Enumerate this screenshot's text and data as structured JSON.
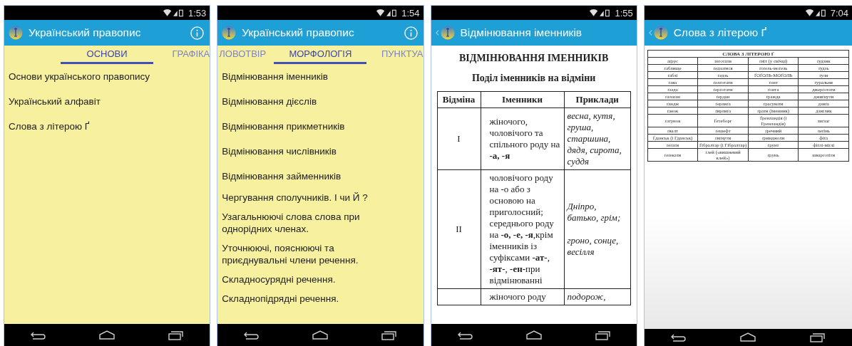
{
  "phones": [
    {
      "kind": "list",
      "status": {
        "time": "1:53"
      },
      "app_bar": {
        "title": "Український правопис",
        "back": false,
        "info": true
      },
      "tabs": [
        {
          "label": "ОСНОВИ",
          "selected": true
        },
        {
          "label": "ГРАФІКА",
          "selected": false
        }
      ],
      "items": [
        "Основи українського правопису",
        "Український алфавіт",
        "Слова з літерою Ґ"
      ]
    },
    {
      "kind": "list",
      "status": {
        "time": "1:54"
      },
      "app_bar": {
        "title": "Український правопис",
        "back": false,
        "info": true
      },
      "tabs": [
        {
          "label": "ЛОВОТВІР",
          "selected": false
        },
        {
          "label": "МОРФОЛОГІЯ",
          "selected": true
        },
        {
          "label": "ПУНКТУА",
          "selected": false
        }
      ],
      "items": [
        "Відмінювання іменників",
        "Відмінювання дієслів",
        "Відмінювання прикметників",
        "Відмінювання числівників",
        "Відмінювання займенників",
        "Чергування сполучників. І чи Й ?",
        "Узагальнюючі слова слова при однорідних членах.",
        "Уточнюючі, пояснюючі та приєднувальні члени речення.",
        "Складносурядні речення.",
        "Складнопідрядні речення."
      ]
    },
    {
      "kind": "article",
      "status": {
        "time": "1:55"
      },
      "app_bar": {
        "title": "Відмінювання іменників",
        "back": true,
        "info": false
      },
      "heading": "ВІДМІНЮВАННЯ ІМЕННИКІВ",
      "subheading": "Поділ іменників на відміни",
      "table": {
        "columns": [
          "Відміна",
          "Іменники",
          "Приклади"
        ],
        "rows": [
          {
            "cells": [
              "I",
              "жіночого, чоловічого та спільного роду на **-а, -я**",
              "весна, кутя, груша, старшина, дядя, сирота, суддя"
            ]
          },
          {
            "cells": [
              "II",
              "чоловічого роду на -о або з основою на приголосний; середнього роду на **-о, -е, -я**,крім іменників із суфіксами **-ат-**, **-ят-**, **-ен-**при відмінюванні",
              "Дніпро, батько, грім;\n\nгроно, сонце, весілля"
            ]
          },
          {
            "cells": [
              "",
              "жіночого роду",
              "подорож,"
            ]
          }
        ]
      }
    },
    {
      "kind": "word_table",
      "status": {
        "time": "7:04"
      },
      "app_bar": {
        "title": "Слова з літерою Ґ",
        "back": true,
        "info": false
      },
      "table": {
        "title": "СЛОВА З ЛІТЕРОЮ Ґ",
        "rows": [
          [
            "аґрус",
            "ґеготати",
            "ґніт (у свічці)",
            "ґудзик"
          ],
          [
            "ґаблище",
            "ґедзатися",
            "ґоґель-моґель",
            "ґудзь"
          ],
          [
            "ґаблі",
            "ґедзь",
            "ҐОҐОЛЬ-МОҐОЛЬ",
            "ґуля"
          ],
          [
            "ґава",
            "ґелґотати",
            "ґонт",
            "ґуральня"
          ],
          [
            "ґазда",
            "ґерґотати",
            "ґонта",
            "джерґотати"
          ],
          [
            "ґалаґан",
            "ґердан",
            "ґражда",
            "джиґнути"
          ],
          [
            "ґандж",
            "ґерлиґа",
            "ґрасувати",
            "дзиґа"
          ],
          [
            "ґанок",
            "ґирлиґа",
            "ґрати (іменник)",
            "дзиґлик"
          ],
          [
            "ґатунок",
            "Ґетеборг",
            "Ґренландія (і Гренландія)",
            "зиґзаг"
          ],
          [
            "ґвалт",
            "ґешефт",
            "ґречний",
            "леґінь"
          ],
          [
            "Ґданськ (і Гданськ)",
            "ґиґнути",
            "ґринджоли",
            "фіґа"
          ],
          [
            "ґеґати",
            "Ґібралтар (і Гібралтар)",
            "ґрунт",
            "фіґлі-міґлі"
          ],
          [
            "ґеґекати",
            "ґлей («вишневий клей»)",
            "ґрунь",
            "шварґотіти"
          ]
        ]
      }
    }
  ]
}
